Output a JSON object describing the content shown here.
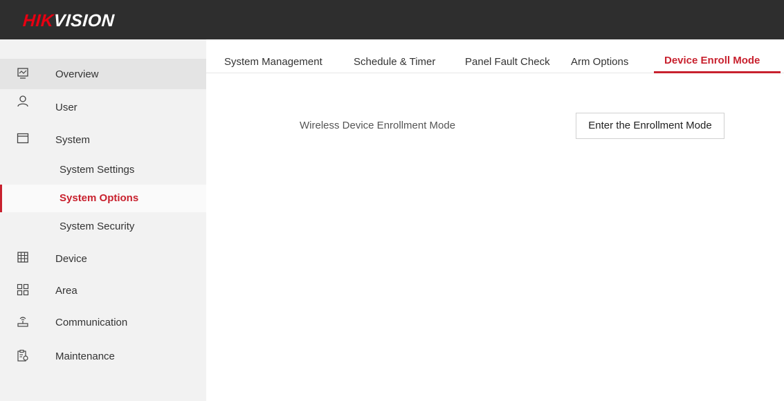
{
  "header": {
    "logo_hik": "HIK",
    "logo_vision": "VISION",
    "bg_color": "#2e2e2e",
    "brand_color": "#e60012"
  },
  "sidebar": {
    "items": [
      {
        "label": "Overview",
        "icon": "monitor-icon"
      },
      {
        "label": "User",
        "icon": "user-icon"
      },
      {
        "label": "System",
        "icon": "window-icon"
      },
      {
        "label": "Device",
        "icon": "grid-icon"
      },
      {
        "label": "Area",
        "icon": "four-squares-icon"
      },
      {
        "label": "Communication",
        "icon": "router-icon"
      },
      {
        "label": "Maintenance",
        "icon": "clipboard-gear-icon"
      }
    ],
    "system_sub_items": [
      {
        "label": "System Settings"
      },
      {
        "label": "System Options",
        "selected": true
      },
      {
        "label": "System Security"
      }
    ]
  },
  "tabs": [
    {
      "label": "System Management"
    },
    {
      "label": "Schedule & Timer"
    },
    {
      "label": "Panel Fault Check"
    },
    {
      "label": "Arm Options"
    },
    {
      "label": "Device Enroll Mode",
      "active": true
    }
  ],
  "main": {
    "field_label": "Wireless Device Enrollment Mode",
    "button_label": "Enter the Enrollment Mode"
  },
  "accent_color": "#c8212e"
}
